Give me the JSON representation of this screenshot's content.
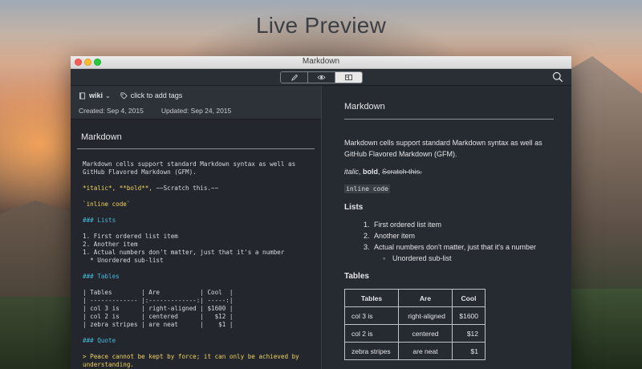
{
  "banner": {
    "title": "Live Preview"
  },
  "window": {
    "title": "Markdown"
  },
  "toolbar": {
    "modes": [
      {
        "name": "edit",
        "icon": "pencil-icon"
      },
      {
        "name": "preview",
        "icon": "eye-icon"
      },
      {
        "name": "split",
        "icon": "split-view-icon"
      }
    ],
    "active_mode": "split"
  },
  "editor": {
    "notebook": "wiki",
    "tags_placeholder": "click to add tags",
    "created": "Created: Sep 4, 2015",
    "updated": "Updated: Sep 24, 2015",
    "cell_title": "Markdown",
    "source_lines": [
      {
        "text": "Markdown cells support standard Markdown syntax as well as",
        "style": ""
      },
      {
        "text": "GitHub Flavored Markdown (GFM).",
        "style": ""
      },
      {
        "text": "",
        "style": "gap"
      },
      {
        "text": "*italic*, **bold**, ~~Scratch this.~~",
        "style": "mixed-emph"
      },
      {
        "text": "",
        "style": "gap"
      },
      {
        "text": "`inline code`",
        "style": "yellow"
      },
      {
        "text": "",
        "style": "gap"
      },
      {
        "text": "### Lists",
        "style": "cyan"
      },
      {
        "text": "",
        "style": "gap"
      },
      {
        "text": "1. First ordered list item",
        "style": ""
      },
      {
        "text": "2. Another item",
        "style": ""
      },
      {
        "text": "1. Actual numbers don't matter, just that it's a number",
        "style": ""
      },
      {
        "text": "  * Unordered sub-list",
        "style": ""
      },
      {
        "text": "",
        "style": "gap"
      },
      {
        "text": "### Tables",
        "style": "cyan"
      },
      {
        "text": "",
        "style": "gap"
      },
      {
        "text": "| Tables        | Are           | Cool  |",
        "style": ""
      },
      {
        "text": "| ------------- |:-------------:| -----:|",
        "style": ""
      },
      {
        "text": "| col 3 is      | right-aligned | $1600 |",
        "style": ""
      },
      {
        "text": "| col 2 is      | centered      |   $12 |",
        "style": ""
      },
      {
        "text": "| zebra stripes | are neat      |    $1 |",
        "style": ""
      },
      {
        "text": "",
        "style": "gap"
      },
      {
        "text": "### Quote",
        "style": "cyan"
      },
      {
        "text": "",
        "style": "gap"
      },
      {
        "text": "> Peace cannot be kept by force; it can only be achieved by",
        "style": "quote"
      },
      {
        "text": "understanding.",
        "style": "quote"
      }
    ]
  },
  "preview": {
    "title": "Markdown",
    "paragraph": "Markdown cells support standard Markdown syntax as well as GitHub Flavored Markdown (GFM).",
    "italic": "italic",
    "bold": "bold",
    "strike": "Scratch this.",
    "inline_code": "inline code",
    "lists_heading": "Lists",
    "list_items": [
      {
        "num": "1.",
        "text": "First ordered list item"
      },
      {
        "num": "2.",
        "text": "Another item"
      },
      {
        "num": "3.",
        "text": "Actual numbers don't matter, just that it's a number"
      }
    ],
    "sub_item": "Unordered sub-list",
    "tables_heading": "Tables",
    "table": {
      "headers": [
        "Tables",
        "Are",
        "Cool"
      ],
      "rows": [
        [
          "col 3 is",
          "right-aligned",
          "$1600"
        ],
        [
          "col 2 is",
          "centered",
          "$12"
        ],
        [
          "zebra stripes",
          "are neat",
          "$1"
        ]
      ]
    }
  }
}
